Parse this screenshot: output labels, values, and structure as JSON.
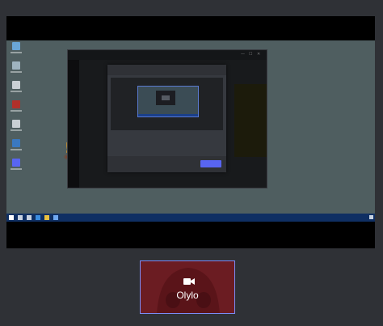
{
  "colors": {
    "background": "#2f3136",
    "desktop": "#4f5e60",
    "taskbar": "#0f2f63",
    "accent": "#5865f2",
    "tile_background": "#6b1c22",
    "tile_border": "#7b8cf7",
    "warning": "#f0a020"
  },
  "desktop_icons": [
    {
      "icon": "recycle-bin-icon",
      "color": "#6aa6d6"
    },
    {
      "icon": "computer-icon",
      "color": "#9fb3bf"
    },
    {
      "icon": "file-icon",
      "color": "#c9cfd4"
    },
    {
      "icon": "game-icon",
      "color": "#b0302a"
    },
    {
      "icon": "file-icon",
      "color": "#c9cfd4"
    },
    {
      "icon": "app-icon",
      "color": "#3a78c0"
    },
    {
      "icon": "discord-icon",
      "color": "#5865f2"
    }
  ],
  "warning_icon": "exclamation-icon",
  "window_controls": {
    "minimize": "—",
    "maximize": "☐",
    "close": "✕"
  },
  "taskbar_icons": [
    "windows-start-icon",
    "search-icon",
    "task-view-icon",
    "edge-icon",
    "folder-icon",
    "store-icon"
  ],
  "tile": {
    "name": "Olylo",
    "icon": "video-camera-icon"
  }
}
